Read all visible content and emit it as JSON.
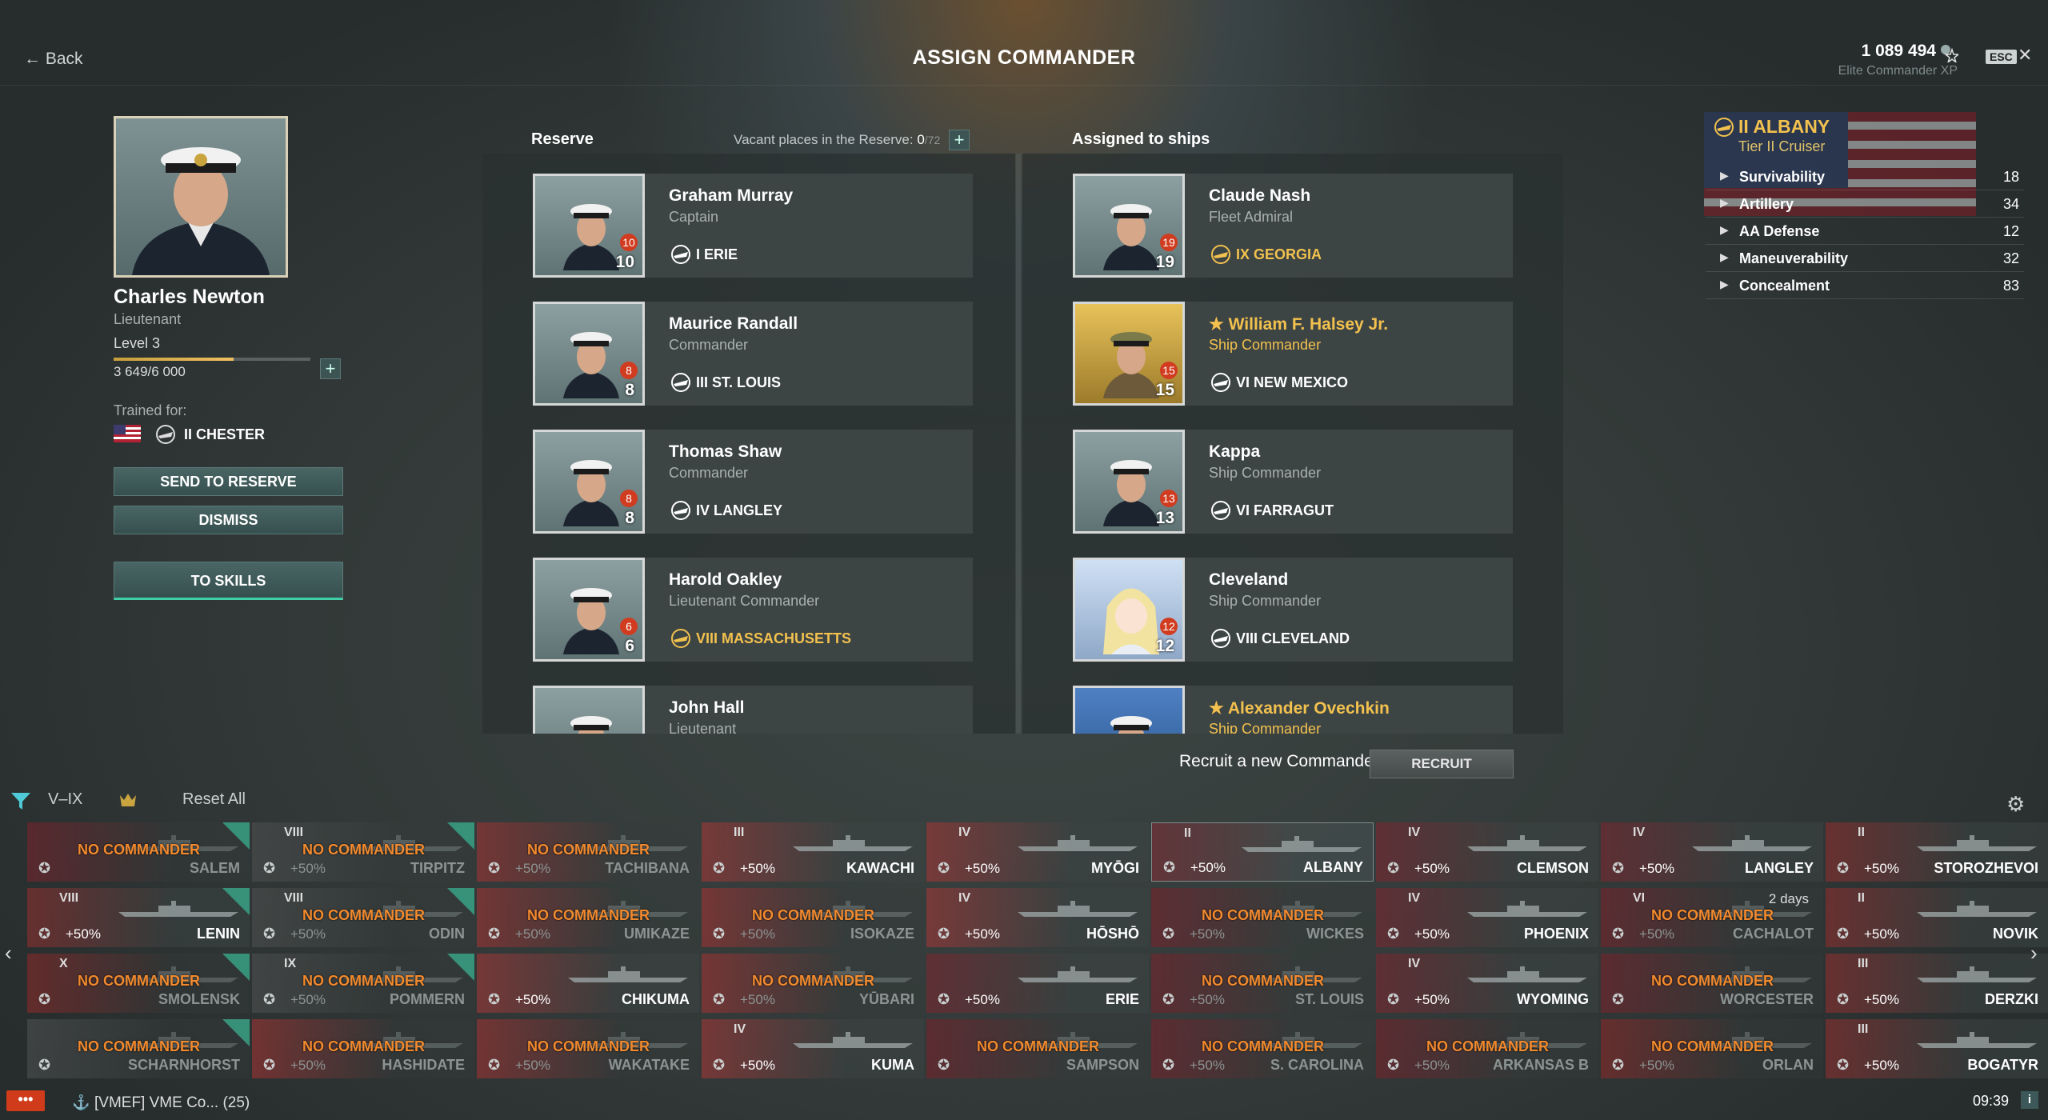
{
  "header": {
    "back_label": "← Back",
    "title": "ASSIGN COMMANDER",
    "xp_value": "1 089 494",
    "xp_label": "Elite Commander XP",
    "esc_label": "ESC",
    "close_label": "✕"
  },
  "commander": {
    "name": "Charles Newton",
    "rank": "Lieutenant",
    "level": "Level 3",
    "xp_text": "3 649/6 000",
    "xp_progress": 0.608,
    "trained_label": "Trained for:",
    "trained_ship": "II CHESTER",
    "buttons": {
      "send_to_reserve": "SEND TO RESERVE",
      "dismiss": "DISMISS",
      "to_skills": "TO SKILLS"
    }
  },
  "reserve": {
    "title": "Reserve",
    "vacant_label": "Vacant places in the Reserve:",
    "vacant_value": "0",
    "vacant_total": "/72",
    "items": [
      {
        "name": "Graham Murray",
        "rank": "Captain",
        "level": "10",
        "badge": "10",
        "ship": "I ERIE",
        "ship_gold": false,
        "photo": "normal"
      },
      {
        "name": "Maurice Randall",
        "rank": "Commander",
        "level": "8",
        "badge": "8",
        "ship": "III ST. LOUIS",
        "ship_gold": false,
        "photo": "normal"
      },
      {
        "name": "Thomas Shaw",
        "rank": "Commander",
        "level": "8",
        "badge": "8",
        "ship": "IV LANGLEY",
        "ship_gold": false,
        "photo": "normal"
      },
      {
        "name": "Harold Oakley",
        "rank": "Lieutenant Commander",
        "level": "6",
        "badge": "6",
        "ship": "VIII MASSACHUSETTS",
        "ship_gold": true,
        "photo": "normal"
      },
      {
        "name": "John Hall",
        "rank": "Lieutenant",
        "level": "",
        "badge": "",
        "ship": "",
        "ship_gold": false,
        "photo": "normal"
      }
    ]
  },
  "assigned": {
    "title": "Assigned to ships",
    "items": [
      {
        "name": "Claude Nash",
        "rank": "Fleet Admiral",
        "level": "19",
        "badge": "19",
        "ship": "IX GEORGIA",
        "ship_gold": true,
        "photo": "normal",
        "star": false
      },
      {
        "name": "William F. Halsey Jr.",
        "rank": "Ship Commander",
        "level": "15",
        "badge": "15",
        "ship": "VI NEW MEXICO",
        "ship_gold": false,
        "photo": "gold",
        "star": true
      },
      {
        "name": "Kappa",
        "rank": "Ship Commander",
        "level": "13",
        "badge": "13",
        "ship": "VI FARRAGUT",
        "ship_gold": false,
        "photo": "normal",
        "star": false
      },
      {
        "name": "Cleveland",
        "rank": "Ship Commander",
        "level": "12",
        "badge": "12",
        "ship": "VIII CLEVELAND",
        "ship_gold": false,
        "photo": "anime",
        "star": false
      },
      {
        "name": "Alexander Ovechkin",
        "rank": "Ship Commander",
        "level": "",
        "badge": "",
        "ship": "",
        "ship_gold": false,
        "photo": "blue",
        "star": true
      }
    ]
  },
  "ship": {
    "name": "II ALBANY",
    "tier": "Tier II Cruiser",
    "stats": [
      {
        "label": "Survivability",
        "value": "18"
      },
      {
        "label": "Artillery",
        "value": "34"
      },
      {
        "label": "AA Defense",
        "value": "12"
      },
      {
        "label": "Maneuverability",
        "value": "32"
      },
      {
        "label": "Concealment",
        "value": "83"
      }
    ]
  },
  "recruit": {
    "label": "Recruit a new Commander",
    "button": "RECRUIT"
  },
  "filters": {
    "tier": "V–IX",
    "reset": "Reset All"
  },
  "carousel": {
    "no_commander": "NO COMMANDER",
    "rows": [
      [
        {
          "tier": "",
          "name": "SALEM",
          "nc": true,
          "bonus": "",
          "corner": true,
          "flag": "us"
        },
        {
          "tier": "VIII",
          "name": "TIRPITZ",
          "nc": true,
          "bonus": "+50%",
          "corner": true,
          "flag": "de"
        },
        {
          "tier": "",
          "name": "TACHIBANA",
          "nc": true,
          "bonus": "+50%",
          "corner": false,
          "flag": "jp"
        },
        {
          "tier": "III",
          "name": "KAWACHI",
          "nc": false,
          "bonus": "+50%",
          "corner": false,
          "flag": "jp"
        },
        {
          "tier": "IV",
          "name": "MYŌGI",
          "nc": false,
          "bonus": "+50%",
          "corner": false,
          "flag": "jp"
        },
        {
          "tier": "II",
          "name": "ALBANY",
          "nc": false,
          "bonus": "+50%",
          "corner": false,
          "flag": "us",
          "selected": true
        },
        {
          "tier": "IV",
          "name": "CLEMSON",
          "nc": false,
          "bonus": "+50%",
          "corner": false,
          "flag": "us"
        },
        {
          "tier": "IV",
          "name": "LANGLEY",
          "nc": false,
          "bonus": "+50%",
          "corner": false,
          "flag": "us"
        },
        {
          "tier": "II",
          "name": "STOROZHEVOI",
          "nc": false,
          "bonus": "+50%",
          "corner": false,
          "flag": "ru"
        }
      ],
      [
        {
          "tier": "VIII",
          "name": "LENIN",
          "nc": false,
          "bonus": "+50%",
          "corner": true,
          "flag": "ru"
        },
        {
          "tier": "VIII",
          "name": "ODIN",
          "nc": true,
          "bonus": "+50%",
          "corner": true,
          "flag": "de"
        },
        {
          "tier": "",
          "name": "UMIKAZE",
          "nc": true,
          "bonus": "+50%",
          "corner": false,
          "flag": "jp"
        },
        {
          "tier": "",
          "name": "ISOKAZE",
          "nc": true,
          "bonus": "+50%",
          "corner": false,
          "flag": "jp"
        },
        {
          "tier": "IV",
          "name": "HŌSHŌ",
          "nc": false,
          "bonus": "+50%",
          "corner": false,
          "flag": "jp"
        },
        {
          "tier": "",
          "name": "WICKES",
          "nc": true,
          "bonus": "+50%",
          "corner": false,
          "flag": "us"
        },
        {
          "tier": "IV",
          "name": "PHOENIX",
          "nc": false,
          "bonus": "+50%",
          "corner": false,
          "flag": "us"
        },
        {
          "tier": "VI",
          "name": "CACHALOT",
          "nc": true,
          "bonus": "+50%",
          "corner": false,
          "flag": "us",
          "days": "2 days"
        },
        {
          "tier": "II",
          "name": "NOVIK",
          "nc": false,
          "bonus": "+50%",
          "corner": false,
          "flag": "ru"
        }
      ],
      [
        {
          "tier": "X",
          "name": "SMOLENSK",
          "nc": true,
          "bonus": "",
          "corner": true,
          "flag": "ru"
        },
        {
          "tier": "IX",
          "name": "POMMERN",
          "nc": true,
          "bonus": "+50%",
          "corner": true,
          "flag": "de"
        },
        {
          "tier": "",
          "name": "CHIKUMA",
          "nc": false,
          "bonus": "+50%",
          "corner": false,
          "flag": "jp"
        },
        {
          "tier": "",
          "name": "YŪBARI",
          "nc": true,
          "bonus": "+50%",
          "corner": false,
          "flag": "jp"
        },
        {
          "tier": "",
          "name": "ERIE",
          "nc": false,
          "bonus": "+50%",
          "corner": false,
          "flag": "us"
        },
        {
          "tier": "",
          "name": "ST. LOUIS",
          "nc": true,
          "bonus": "+50%",
          "corner": false,
          "flag": "us"
        },
        {
          "tier": "IV",
          "name": "WYOMING",
          "nc": false,
          "bonus": "+50%",
          "corner": false,
          "flag": "us"
        },
        {
          "tier": "",
          "name": "WORCESTER",
          "nc": true,
          "bonus": "",
          "corner": false,
          "flag": "us"
        },
        {
          "tier": "III",
          "name": "DERZKI",
          "nc": false,
          "bonus": "+50%",
          "corner": false,
          "flag": "ru"
        }
      ],
      [
        {
          "tier": "",
          "name": "SCHARNHORST",
          "nc": true,
          "bonus": "",
          "corner": true,
          "flag": "de"
        },
        {
          "tier": "",
          "name": "HASHIDATE",
          "nc": true,
          "bonus": "+50%",
          "corner": false,
          "flag": "jp"
        },
        {
          "tier": "",
          "name": "WAKATAKE",
          "nc": true,
          "bonus": "+50%",
          "corner": false,
          "flag": "jp"
        },
        {
          "tier": "IV",
          "name": "KUMA",
          "nc": false,
          "bonus": "+50%",
          "corner": false,
          "flag": "jp"
        },
        {
          "tier": "",
          "name": "SAMPSON",
          "nc": true,
          "bonus": "",
          "corner": false,
          "flag": "us"
        },
        {
          "tier": "",
          "name": "S. CAROLINA",
          "nc": true,
          "bonus": "+50%",
          "corner": false,
          "flag": "us"
        },
        {
          "tier": "",
          "name": "ARKANSAS B",
          "nc": true,
          "bonus": "+50%",
          "corner": false,
          "flag": "us"
        },
        {
          "tier": "",
          "name": "ORLAN",
          "nc": true,
          "bonus": "+50%",
          "corner": false,
          "flag": "ru"
        },
        {
          "tier": "III",
          "name": "BOGATYR",
          "nc": false,
          "bonus": "+50%",
          "corner": false,
          "flag": "ru"
        }
      ]
    ]
  },
  "bottom": {
    "chat_label": "•••",
    "clan": "[VMEF] VME Co... (25)",
    "time": "09:39",
    "info": "i"
  },
  "colors": {
    "accent": "#f2c14e",
    "teal": "#3fcfa9",
    "badge": "#d13b1f",
    "nc_orange": "#f28a2e"
  }
}
